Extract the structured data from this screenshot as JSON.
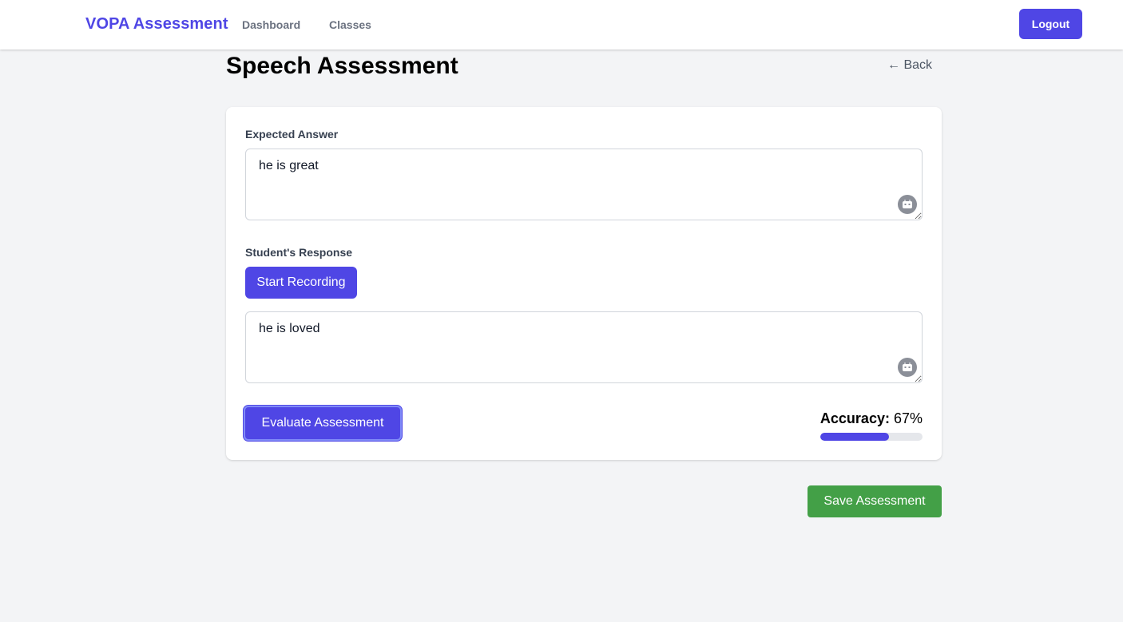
{
  "nav": {
    "brand": "VOPA Assessment",
    "links": [
      {
        "label": "Dashboard"
      },
      {
        "label": "Classes"
      }
    ],
    "logout_label": "Logout"
  },
  "page": {
    "title": "Speech Assessment",
    "back_label": "← Back"
  },
  "form": {
    "expected": {
      "label": "Expected Answer",
      "value": "he is great",
      "icon": "robot-icon"
    },
    "response": {
      "label": "Student's Response",
      "record_label": "Start Recording",
      "value": "he is loved",
      "icon": "robot-icon"
    },
    "evaluate_label": "Evaluate Assessment",
    "accuracy": {
      "label": "Accuracy:",
      "value_text": "67%",
      "fraction": 0.67
    }
  },
  "footer": {
    "save_label": "Save Assessment"
  },
  "colors": {
    "primary": "#4f46e5",
    "success": "#43a047",
    "background": "#f3f4f6"
  }
}
